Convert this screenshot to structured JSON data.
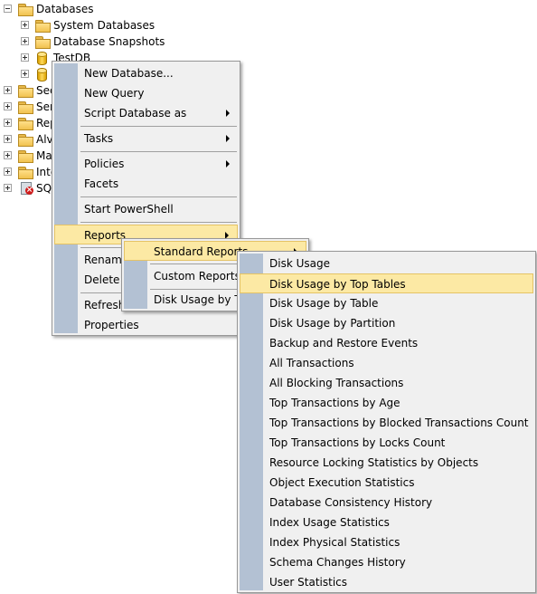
{
  "tree": {
    "databases": "Databases",
    "system_databases": "System Databases",
    "database_snapshots": "Database Snapshots",
    "testdb": "TestDB",
    "security": "Sec",
    "server_objects": "Ser",
    "replication": "Rep",
    "alwayson": "Alv",
    "management": "Ma",
    "integration": "Inte",
    "sql_agent": "SQ"
  },
  "context_menu": {
    "new_database": "New Database...",
    "new_query": "New Query",
    "script_database_as": "Script Database as",
    "tasks": "Tasks",
    "policies": "Policies",
    "facets": "Facets",
    "start_powershell": "Start PowerShell",
    "reports": "Reports",
    "rename": "Rename",
    "delete": "Delete",
    "refresh": "Refresh",
    "properties": "Properties"
  },
  "reports_menu": {
    "standard_reports": "Standard Reports",
    "custom_reports": "Custom Reports...",
    "recent": "Disk Usage by Top"
  },
  "standard_reports": [
    "Disk Usage",
    "Disk Usage by Top Tables",
    "Disk Usage by Table",
    "Disk Usage by Partition",
    "Backup and Restore Events",
    "All Transactions",
    "All Blocking Transactions",
    "Top Transactions by Age",
    "Top Transactions by Blocked Transactions Count",
    "Top Transactions by Locks Count",
    "Resource Locking Statistics by Objects",
    "Object Execution Statistics",
    "Database Consistency History",
    "Index Usage Statistics",
    "Index Physical Statistics",
    "Schema Changes History",
    "User Statistics"
  ],
  "colors": {
    "highlight": "#fce9a4",
    "gutter": "#b3c1d3",
    "menu_bg": "#f0f0f0"
  }
}
